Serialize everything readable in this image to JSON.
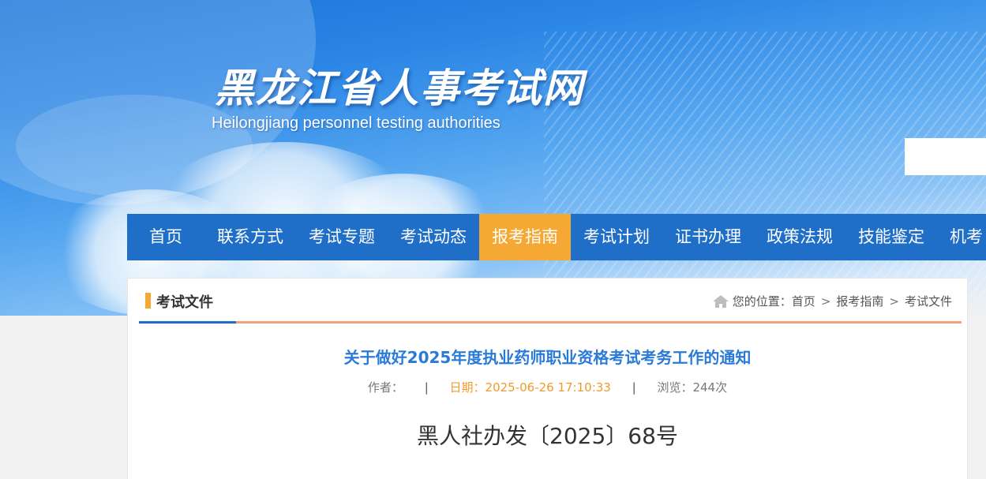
{
  "header": {
    "site_title": "黑龙江省人事考试网",
    "site_subtitle": "Heilongjiang personnel testing authorities",
    "search_placeholder": ""
  },
  "nav": {
    "items": [
      {
        "label": "首页",
        "active": false
      },
      {
        "label": "联系方式",
        "active": false
      },
      {
        "label": "考试专题",
        "active": false
      },
      {
        "label": "考试动态",
        "active": false
      },
      {
        "label": "报考指南",
        "active": true
      },
      {
        "label": "考试计划",
        "active": false
      },
      {
        "label": "证书办理",
        "active": false
      },
      {
        "label": "政策法规",
        "active": false
      },
      {
        "label": "技能鉴定",
        "active": false
      },
      {
        "label": "机考",
        "active": false
      }
    ]
  },
  "panel": {
    "title": "考试文件",
    "breadcrumb": {
      "prefix": "您的位置：",
      "items": [
        "首页",
        "报考指南",
        "考试文件"
      ],
      "separator": ">"
    }
  },
  "article": {
    "title": "关于做好2025年度执业药师职业资格考试考务工作的通知",
    "author_label": "作者：",
    "author": "",
    "date_text": "日期：2025-06-26 17:10:33",
    "views_text": "浏览：244次",
    "meta_divider": "|",
    "doc_number": "黑人社办发〔2025〕68号"
  },
  "colors": {
    "nav_bg": "#1f6fc9",
    "nav_active": "#f5a833",
    "title_blue": "#2a7ad8",
    "date_orange": "#f09a2e"
  }
}
